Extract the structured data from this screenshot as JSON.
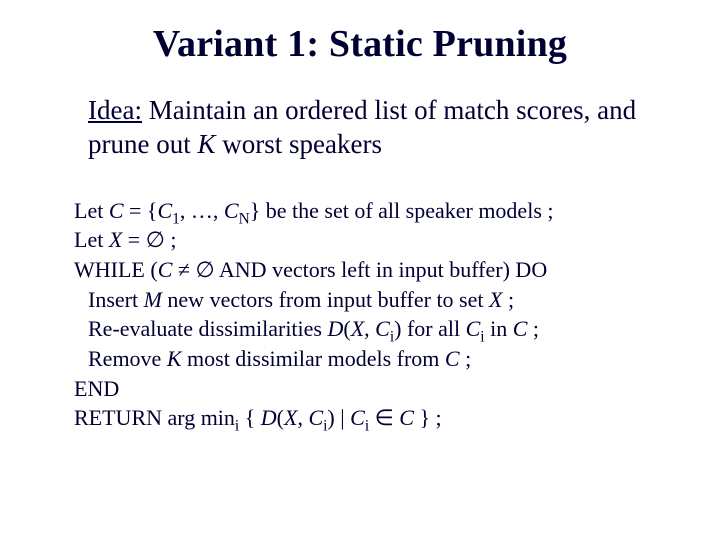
{
  "title": "Variant 1: Static Pruning",
  "idea": {
    "label": "Idea:",
    "t1": " Maintain an ordered list of match scores, and prune out ",
    "K": "K",
    "t2": " worst speakers"
  },
  "algo": {
    "l1": {
      "a": "Let ",
      "C": "C",
      "b": " = {",
      "C1": "C",
      "s1": "1",
      "c": ", …, ",
      "CN": "C",
      "sN": "N",
      "d": "} be the set of all speaker models ;"
    },
    "l2": {
      "a": "Let ",
      "X": "X",
      "b": " = ",
      "empty": "∅",
      "c": " ;"
    },
    "l3": {
      "a": "WHILE (",
      "C": "C",
      "b": " ≠ ",
      "empty": "∅",
      "c": " AND vectors left in input buffer) DO"
    },
    "l4": {
      "a": "Insert ",
      "M": "M",
      "b": " new vectors from input buffer to set ",
      "X": "X",
      "c": " ;"
    },
    "l5": {
      "a": "Re-evaluate dissimilarities ",
      "D": "D",
      "p": "(",
      "X": "X",
      "comma": ", ",
      "Ci": "C",
      "si": "i",
      "q": ") for all ",
      "Ci2": "C",
      "si2": "i",
      "r": " in ",
      "C": "C",
      "s": " ;"
    },
    "l6": {
      "a": "Remove ",
      "K": "K",
      "b": " most dissimilar models from ",
      "C": "C",
      "c": " ;"
    },
    "l7": "END",
    "l8": {
      "a": "RETURN arg min",
      "si": "i",
      "b": " { ",
      "D": "D",
      "p": "(",
      "X": "X",
      "comma": ", ",
      "Ci": "C",
      "sii": "i",
      "q": ") | ",
      "Ci2": "C",
      "sii2": "i",
      "r": " ∈ ",
      "C": "C",
      "s": " } ;"
    }
  }
}
